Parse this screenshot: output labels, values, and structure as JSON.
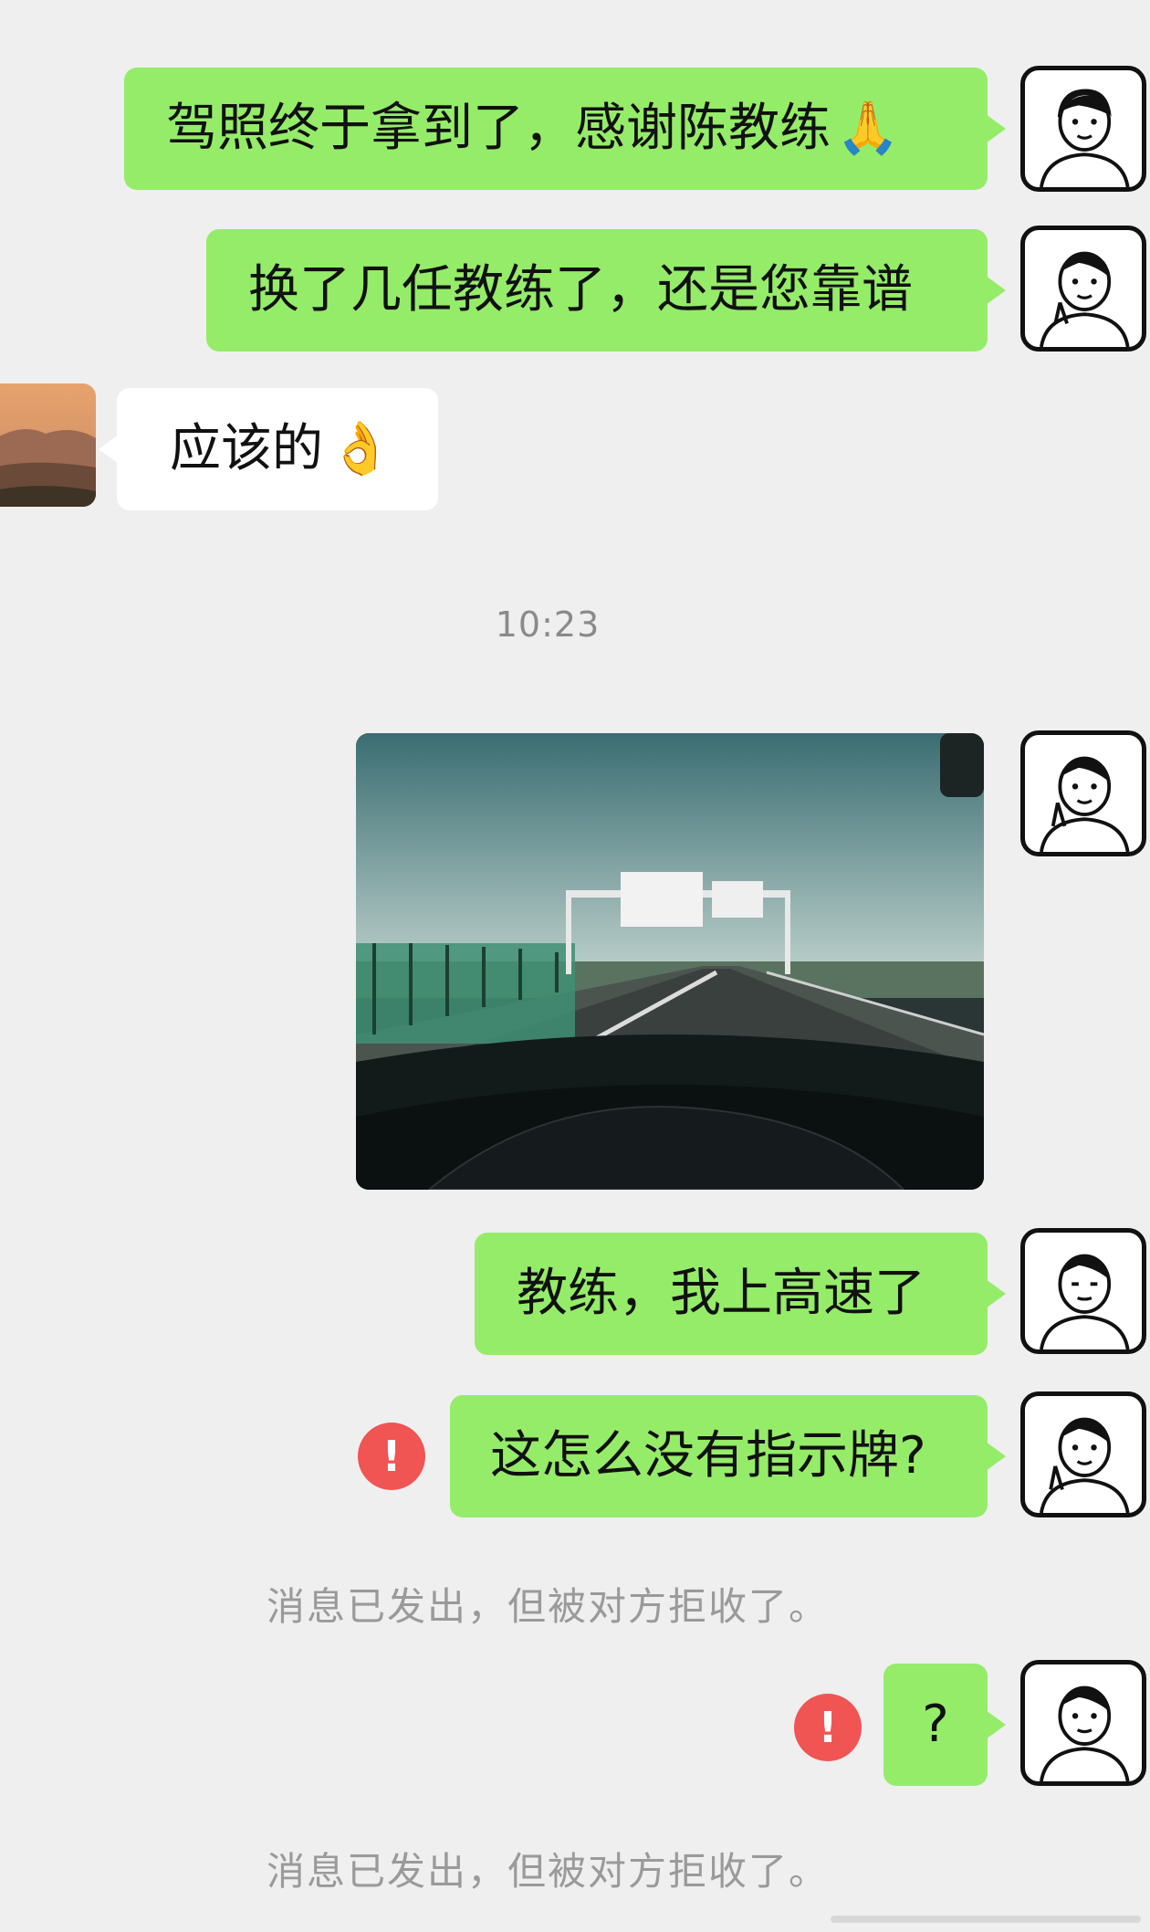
{
  "messages": {
    "m1_text": "驾照终于拿到了，感谢陈教练",
    "m1_emoji": "🙏",
    "m2_text": "换了几任教练了，还是您靠谱",
    "m3_text": "应该的",
    "m3_emoji": "👌",
    "timestamp": "10:23",
    "m5_text": "教练，我上高速了",
    "m6_text": "这怎么没有指示牌?",
    "m7_text": "?"
  },
  "errors": {
    "symbol": "!",
    "rejected_notice": "消息已发出，但被对方拒收了。"
  },
  "colors": {
    "sent_bubble": "#95ec69",
    "received_bubble": "#ffffff",
    "background": "#efefef",
    "error_badge": "#f05453"
  },
  "icons": {
    "self_avatar": "cartoon-boy-avatar",
    "contact_avatar": "mountain-sunset-photo",
    "error": "exclamation-circle-icon"
  }
}
